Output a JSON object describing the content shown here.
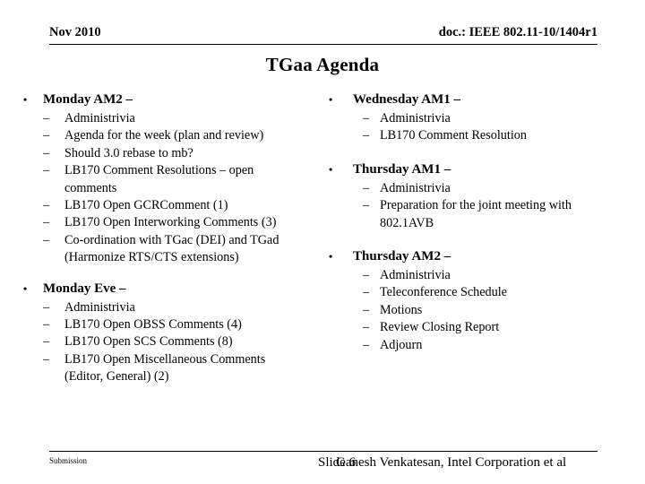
{
  "header": {
    "date": "Nov 2010",
    "doc_id": "doc.: IEEE 802.11-10/1404r1"
  },
  "title": "TGaa Agenda",
  "left_column": [
    {
      "heading": "Monday AM2 –",
      "items": [
        {
          "line1": "Administrivia",
          "line2": ""
        },
        {
          "line1": "Agenda for the week (plan and review)",
          "line2": ""
        },
        {
          "line1": "Should 3.0 rebase to mb?",
          "line2": ""
        },
        {
          "line1": "LB170 Comment Resolutions – open",
          "line2": "comments"
        },
        {
          "line1": "LB170 Open GCRComment (1)",
          "line2": ""
        },
        {
          "line1": "LB170 Open Interworking Comments (3)",
          "line2": ""
        },
        {
          "line1": "Co-ordination with TGac (DEI) and TGad",
          "line2": "(Harmonize RTS/CTS extensions)"
        }
      ]
    },
    {
      "heading": "Monday Eve –",
      "items": [
        {
          "line1": "Administrivia",
          "line2": ""
        },
        {
          "line1": "LB170 Open OBSS Comments (4)",
          "line2": ""
        },
        {
          "line1": "LB170 Open SCS Comments (8)",
          "line2": ""
        },
        {
          "line1": "LB170 Open Miscellaneous Comments",
          "line2": "(Editor, General) (2)"
        }
      ]
    }
  ],
  "right_column": [
    {
      "heading": "Wednesday AM1  –",
      "items": [
        {
          "line1": "Administrivia",
          "line2": ""
        },
        {
          "line1": "LB170 Comment Resolution",
          "line2": ""
        }
      ]
    },
    {
      "heading": "Thursday AM1 –",
      "items": [
        {
          "line1": "Administrivia",
          "line2": ""
        },
        {
          "line1": "Preparation for the joint meeting with",
          "line2": "802.1AVB"
        }
      ]
    },
    {
      "heading": "Thursday AM2 –",
      "items": [
        {
          "line1": "Administrivia",
          "line2": ""
        },
        {
          "line1": "Teleconference Schedule",
          "line2": ""
        },
        {
          "line1": "Motions",
          "line2": ""
        },
        {
          "line1": "Review Closing Report",
          "line2": ""
        },
        {
          "line1": "Adjourn",
          "line2": ""
        }
      ]
    }
  ],
  "footer": {
    "submission": "Submission",
    "slide_number": "Slide 6",
    "author": "Ganesh Venkatesan, Intel Corporation et al"
  },
  "glyphs": {
    "bullet": "•",
    "dash": "–"
  }
}
